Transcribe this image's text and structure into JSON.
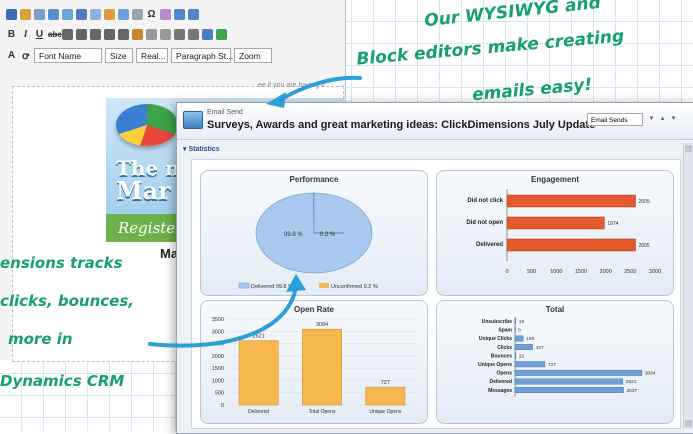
{
  "colors": {
    "annotation": "#17a06c",
    "arrow": "#2b9fd6",
    "bar_orange": "#e5592c",
    "bar_yellow": "#f6b84e",
    "bar_blue": "#6e9fd6",
    "panel_border": "#b9c7d8"
  },
  "editor": {
    "toolbar_row3": {
      "font_name": "Font Name",
      "size": "Size",
      "real": "Real...",
      "paragraph": "Paragraph St...",
      "zoom": "Zoom"
    },
    "help_hint": "ee if you are having tr",
    "banner": {
      "line1": "The ne",
      "line2": "Mar",
      "register": "Registe",
      "below": "Ma"
    }
  },
  "email_send": {
    "kicker": "Email Send",
    "subject": "Surveys, Awards and great marketing ideas: ClickDimensions July Update",
    "dropdown": "Email Sends",
    "section": "Statistics"
  },
  "chart_data": [
    {
      "type": "pie",
      "title": "Performance",
      "categories": [
        "Delivered",
        "Unconfirmed"
      ],
      "legend": [
        "Delivered 99.8 %",
        "Unconfirmed 0.2 %"
      ],
      "values": [
        99.8,
        0.2
      ],
      "labels": [
        "99.8 %",
        "0.2 %"
      ]
    },
    {
      "type": "bar",
      "orientation": "horizontal",
      "title": "Engagement",
      "categories": [
        "Did not click",
        "Did not open",
        "Delivered"
      ],
      "values": [
        2605,
        1974,
        2605
      ],
      "xlim": [
        0,
        3000
      ],
      "ticks": [
        "0",
        "500",
        "1000",
        "1500",
        "2000",
        "2500",
        "3000"
      ]
    },
    {
      "type": "bar",
      "title": "Open Rate",
      "categories": [
        "Delivered",
        "Total Opens",
        "Unique Opens"
      ],
      "values": [
        2621,
        3084,
        727
      ],
      "value_labels": [
        "2621",
        "3084",
        "727"
      ],
      "ylim": [
        0,
        3500
      ],
      "ticks": [
        "0",
        "500",
        "1000",
        "1500",
        "2000",
        "2500",
        "3000",
        "3500"
      ]
    },
    {
      "type": "bar",
      "orientation": "horizontal",
      "title": "Total",
      "categories": [
        "Unsubscribe",
        "Spam",
        "Unique Clicks",
        "Clicks",
        "Bounces",
        "Unique Opens",
        "Opens",
        "Delivered",
        "Messages"
      ],
      "values": [
        19,
        0,
        198,
        427,
        22,
        727,
        3084,
        2621,
        2637
      ],
      "value_labels": [
        "19",
        "0",
        "198",
        "427",
        "22",
        "727",
        "3084",
        "2621",
        "2637"
      ],
      "xlim": [
        0,
        3500
      ]
    }
  ],
  "annotations": {
    "top_right": [
      "Our WYSIWYG and",
      "Block editors make creating",
      "emails easy!"
    ],
    "bottom_left": [
      "ensions tracks",
      "clicks, bounces,",
      "more in",
      "Dynamics CRM"
    ]
  }
}
